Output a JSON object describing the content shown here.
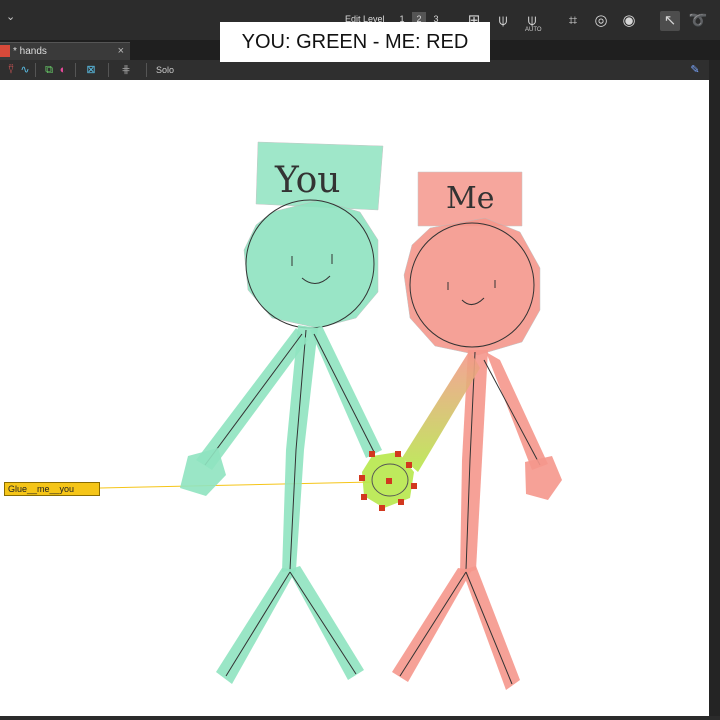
{
  "overlay": {
    "title": "YOU: GREEN - ME: RED"
  },
  "topbar": {
    "edit_level_label": "Edit Level",
    "levels": [
      "1",
      "2",
      "3"
    ],
    "active_level": "2",
    "auto_label": "AUTO"
  },
  "tab": {
    "label": "* hands",
    "close": "×"
  },
  "toolbar2": {
    "solo_label": "Solo"
  },
  "canvas": {
    "glue_label": "Glue__me__you",
    "you_text": "You",
    "me_text": "Me",
    "colors": {
      "green": "#8fe3c0",
      "red": "#f5978c",
      "glue": "#b7e84b",
      "handle": "#d2381f"
    }
  }
}
